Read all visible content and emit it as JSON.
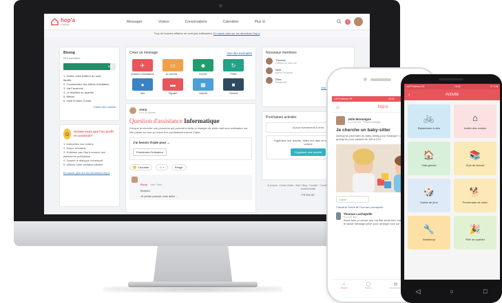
{
  "desktop": {
    "logo": {
      "name": "hop'a",
      "tagline": "Pairing"
    },
    "nav": [
      "Messages",
      "Voisins",
      "Conversations",
      "Calendrier",
      "Plus ☰"
    ],
    "notification_count": "3",
    "info_bar": {
      "text": "Trop de bonnes affaires ne sont pas suffisantes.",
      "link": "En savoir plus sur les directives Hop'a"
    },
    "group": {
      "title": "Bisong",
      "members": "813 membres",
      "progress_label": "90%",
      "progress": 0.9,
      "steps": [
        "1. Invitez votre bailleur au suivi",
        "   famille",
        "2. Commandez des lettres d'invitation",
        "3. Via Facebook",
        "4. Le dépliant du quartier",
        "5. Affiche",
        "6. Voilà et dans Comia"
      ],
      "steps_link": "Inviter des voisins"
    },
    "tips": {
      "title": "Sentez-vous que l'on profit et construit?",
      "items": [
        "1. Interpellez vos voisins",
        "2. Soyez serviable",
        "3. N'utilisez pas Hop'a comme une plateforme publicitaire",
        "4. Gardez le dialogue constructif",
        "5. Utilisez votre véritable identité"
      ],
      "link": "En savoir plus sur les directives Hop'a"
    },
    "create": {
      "title": "Créer un message",
      "link": "Voir des exemples",
      "tiles": [
        {
          "label": "Question d'assistance",
          "color": "#e8555b",
          "icon": "✈"
        },
        {
          "label": "Je cherche ...",
          "color": "#f0a04b",
          "icon": "▭"
        },
        {
          "label": "Donner",
          "color": "#1f9d6e",
          "icon": "◆"
        },
        {
          "label": "Prêter",
          "color": "#22a287",
          "icon": "↻"
        },
        {
          "label": "Idée",
          "color": "#3b82c4",
          "icon": "●"
        },
        {
          "label": "Signaler",
          "color": "#e8555b",
          "icon": "▬"
        },
        {
          "label": "Activité",
          "color": "#4a9fd8",
          "icon": "▦"
        },
        {
          "label": "Général",
          "color": "#2f4a60",
          "icon": "■"
        }
      ]
    },
    "post": {
      "author": "Anna",
      "time": "Il y a 19 heures",
      "title_prefix": "Question d'assistance",
      "title_suffix": "Informatique",
      "text": "Est-que je cherche une personne qui pourrait m'aider à changer de boite mail mon ordinateur car elle plante sur leur pc merci très cordialement Anne Claire.",
      "help_q": "J'ai besoin d'aide pour ...",
      "help_btn": "Problèmes Ordinateur",
      "reactions": [
        "Chouette",
        "☺ +",
        "Réagir"
      ],
      "comment_name": "Rudy",
      "comment_meta": "dans Tsefe",
      "comment_text": "Bonjour,",
      "comment_more": "Je pense pouvoir vous aider ..."
    },
    "new_members": {
      "title": "Nouveaux membres",
      "items": [
        {
          "name": "Thomas",
          "sub": "Chemin de Sem rue"
        },
        {
          "name": "Noel",
          "sub": "Bonne Nouvelle"
        },
        {
          "name": "Elise",
          "sub": "Baudevelli"
        }
      ],
      "link": "Vos nouveaux membres"
    },
    "next_activities": {
      "title": "Prochaines activités",
      "box1": "Aucun événement à venir",
      "box2": "Organisez une activité, faites une date et rencontrez vos voisins",
      "button": "Organiser une activité"
    },
    "footer": "À propos · Centre d'aide · Aide / Blog · Contact · Conditions · Déclaration de confidentialité",
    "langs": "FR  EN  DE"
  },
  "iphone": {
    "status_left": "•••ll Proximus 4G",
    "status_time": "15:44",
    "app_title": "hop'a",
    "author": "Julie Montaigne",
    "meta": "Il y a 22 min. · Passé la Brégle",
    "title": "Je cherche un baby-sitter",
    "text": "Quelqu'un peut faire du baby-sitting pour Solange? Concrètement je cherche quelqu'un pour samedi de 18h à 22h.",
    "reply_placeholder": "J'aime",
    "liked_a": "Claudine Faivre",
    "liked_mid": "et",
    "liked_b": "Thomas Lachapelle",
    "commenter": "Thomas Lachapelle",
    "comment_time": "Il y a 20 min.",
    "comment": "Salut Julie, je pense que ma fille serait bien intéressée ce samedi. Je te laisse message privé pour arranger tout ça!",
    "tabs": [
      {
        "label": "Accueil",
        "icon": "⌂",
        "active": true
      },
      {
        "label": "Voisins",
        "icon": "◯",
        "active": false
      },
      {
        "label": "Conversations",
        "icon": "▤",
        "active": false
      },
      {
        "label": "Menu",
        "icon": "☰",
        "active": false
      }
    ]
  },
  "android": {
    "status_left": "•••ll Proximus 4G",
    "status_time": "15:44",
    "status_right": "47 % ■",
    "app_title": "Activité",
    "back_icon": "‹",
    "tiles": [
      {
        "label": "Randonnée à vélo",
        "color": "#cfe9f6",
        "icon": "🚲"
      },
      {
        "label": "Inviter des voisins",
        "color": "#fce1e1",
        "icon": "⌂"
      },
      {
        "label": "Vide-grenier",
        "color": "#d8f0d9",
        "icon": "🏠"
      },
      {
        "label": "Club de lecture",
        "color": "#fbe9b7",
        "icon": "📚"
      },
      {
        "label": "Soirée de jeux",
        "color": "#dfeaf8",
        "icon": "🎲"
      },
      {
        "label": "Promenade de chien",
        "color": "#fbe9b7",
        "icon": "🐕"
      },
      {
        "label": "Workshop",
        "color": "#fde0a6",
        "icon": "🔧"
      },
      {
        "label": "Fête de quartier",
        "color": "#e1f2d4",
        "icon": "🎉"
      }
    ]
  }
}
